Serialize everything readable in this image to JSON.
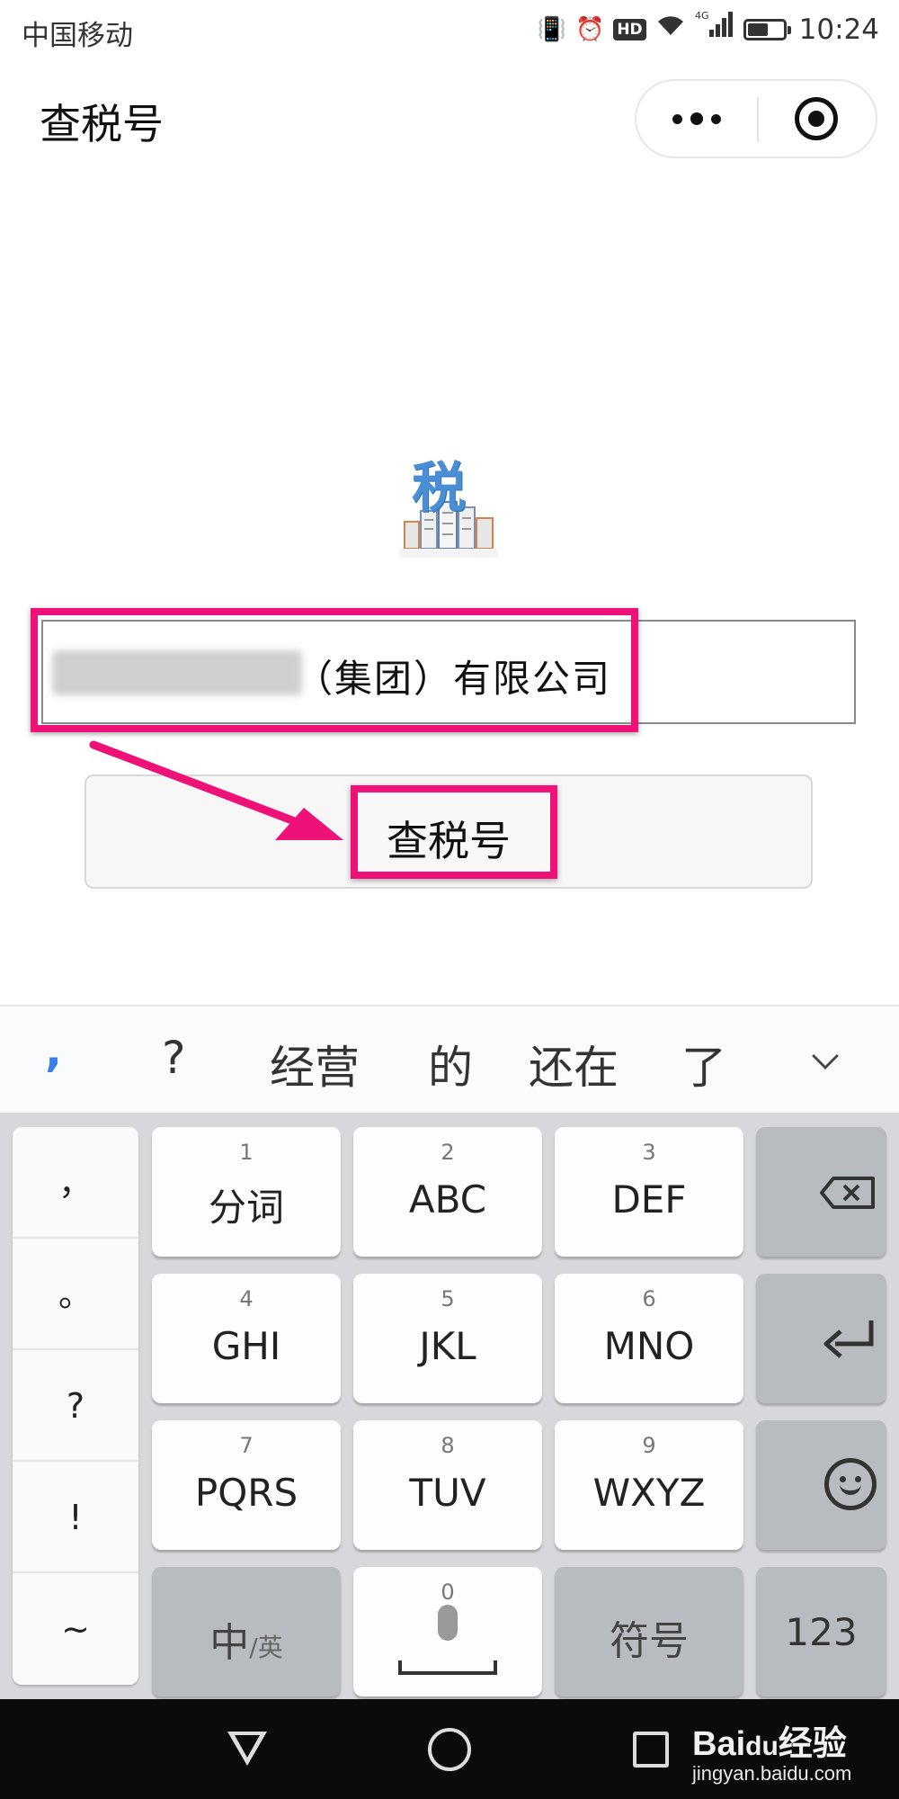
{
  "status_bar": {
    "carrier": "中国移动",
    "time": "10:24",
    "network": "4G",
    "hd": "HD",
    "battery_level": 0.55
  },
  "nav": {
    "title": "查税号"
  },
  "logo": {
    "char": "税"
  },
  "company_input": {
    "value": "（集团）有限公司"
  },
  "query_button": {
    "label": "查税号"
  },
  "annotation": {
    "color": "#ee1177"
  },
  "suggestions": [
    ",",
    "?",
    "经营",
    "的",
    "还在",
    "了"
  ],
  "keyboard": {
    "punctuation": [
      "，",
      "。",
      "?",
      "!",
      "~"
    ],
    "keys": [
      {
        "num": "1",
        "label": "分词"
      },
      {
        "num": "2",
        "label": "ABC"
      },
      {
        "num": "3",
        "label": "DEF"
      },
      {
        "num": "4",
        "label": "GHI"
      },
      {
        "num": "5",
        "label": "JKL"
      },
      {
        "num": "6",
        "label": "MNO"
      },
      {
        "num": "7",
        "label": "PQRS"
      },
      {
        "num": "8",
        "label": "TUV"
      },
      {
        "num": "9",
        "label": "WXYZ"
      }
    ],
    "zh_label": "中",
    "en_label": "/英",
    "space_num": "0",
    "symbol_label": "符号",
    "num_label": "123"
  },
  "watermark": {
    "brand_left": "Bai",
    "brand_mid": "du",
    "brand_right": "经验",
    "url": "jingyan.baidu.com"
  }
}
